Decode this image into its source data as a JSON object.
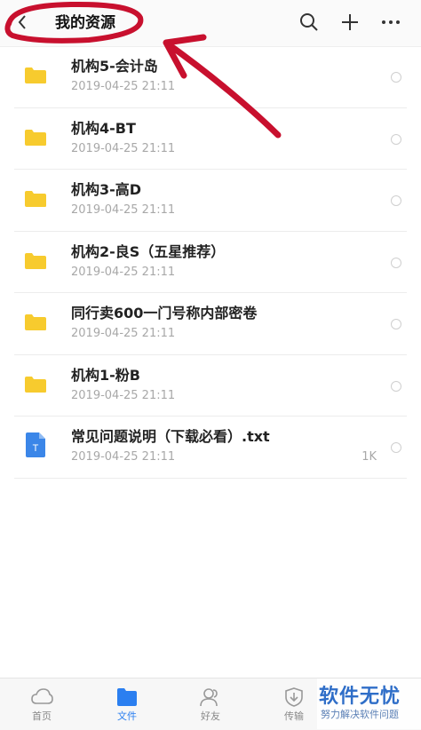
{
  "header": {
    "title": "我的资源",
    "icons": [
      "back-icon",
      "search-icon",
      "plus-icon",
      "more-icon"
    ]
  },
  "files": [
    {
      "name": "机构5-会计岛",
      "date": "2019-04-25 21:11",
      "size": "",
      "type": "folder"
    },
    {
      "name": "机构4-BT",
      "date": "2019-04-25 21:11",
      "size": "",
      "type": "folder"
    },
    {
      "name": "机构3-高D",
      "date": "2019-04-25 21:11",
      "size": "",
      "type": "folder"
    },
    {
      "name": "机构2-良S（五星推荐）",
      "date": "2019-04-25 21:11",
      "size": "",
      "type": "folder"
    },
    {
      "name": "同行卖600一门号称内部密卷",
      "date": "2019-04-25 21:11",
      "size": "",
      "type": "folder"
    },
    {
      "name": "机构1-粉B",
      "date": "2019-04-25 21:11",
      "size": "",
      "type": "folder"
    },
    {
      "name": "常见问题说明（下载必看）.txt",
      "date": "2019-04-25 21:11",
      "size": "1K",
      "type": "txt"
    }
  ],
  "tabs": [
    {
      "label": "首页",
      "icon": "home-icon",
      "active": false
    },
    {
      "label": "文件",
      "icon": "file-icon",
      "active": true
    },
    {
      "label": "好友",
      "icon": "friends-icon",
      "active": false
    },
    {
      "label": "传输",
      "icon": "transfer-icon",
      "active": false
    }
  ],
  "watermark": {
    "main": "软件无忧",
    "sub": "努力解决软件问题"
  },
  "colors": {
    "accent": "#2b7ff0",
    "folder": "#f7cb2e",
    "annotation": "#c8102e"
  }
}
